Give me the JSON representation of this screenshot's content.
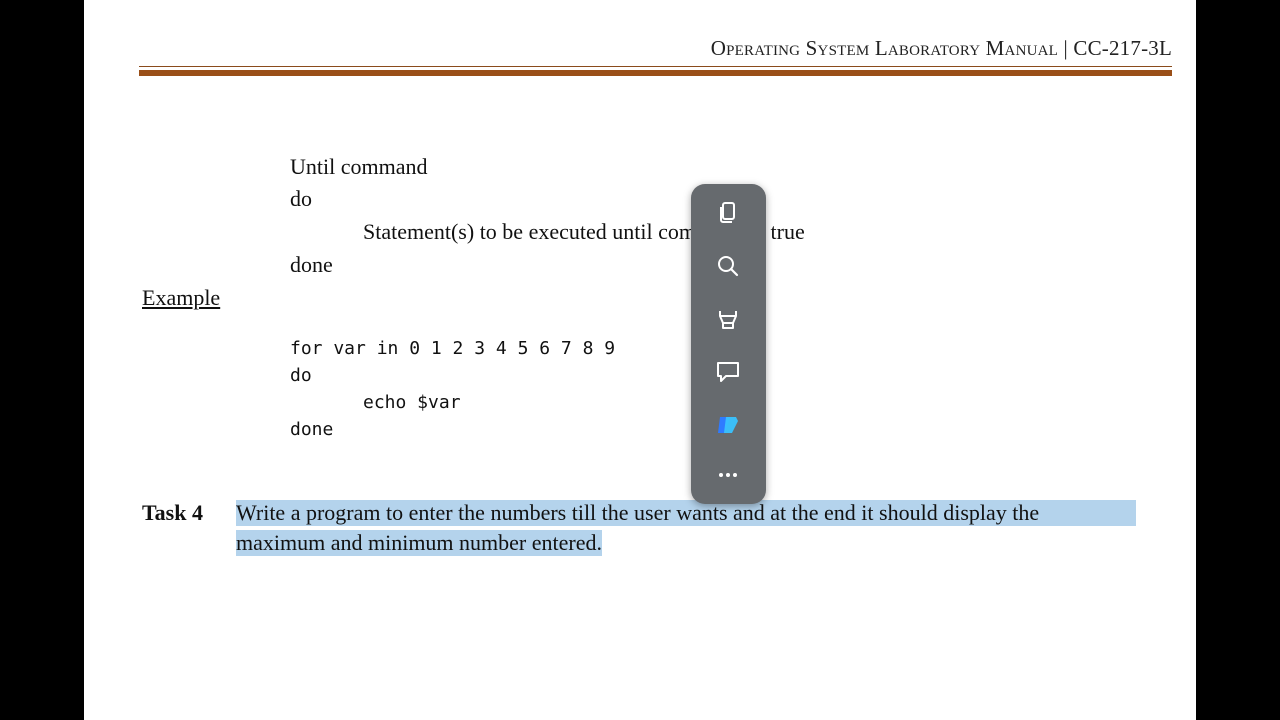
{
  "header": {
    "title": "Operating System Laboratory Manual",
    "code": "CC-217-3L"
  },
  "syntax": {
    "line1": "Until  command",
    "line2": "do",
    "line3": "Statement(s)  to be executed  until  command  is  true",
    "line4": "done"
  },
  "example_label": "Example",
  "code": {
    "line1": "for var in 0 1 2 3 4 5 6 7 8 9",
    "line2": "do",
    "line3": "echo $var",
    "line4": "done"
  },
  "task": {
    "label": "Task 4",
    "text_line1": "Write a program to enter the numbers  till  the user wants and at the end it should display  the",
    "text_line2": "maximum  and minimum  number  entered."
  },
  "toolbar": {
    "icons": [
      "copy-icon",
      "search-icon",
      "highlighter-icon",
      "comment-icon",
      "copilot-icon",
      "more-icon"
    ],
    "colors": {
      "background": "#666a6e",
      "icon": "#ffffff",
      "copilot_a": "#2f7bff",
      "copilot_b": "#39c3ff"
    }
  }
}
